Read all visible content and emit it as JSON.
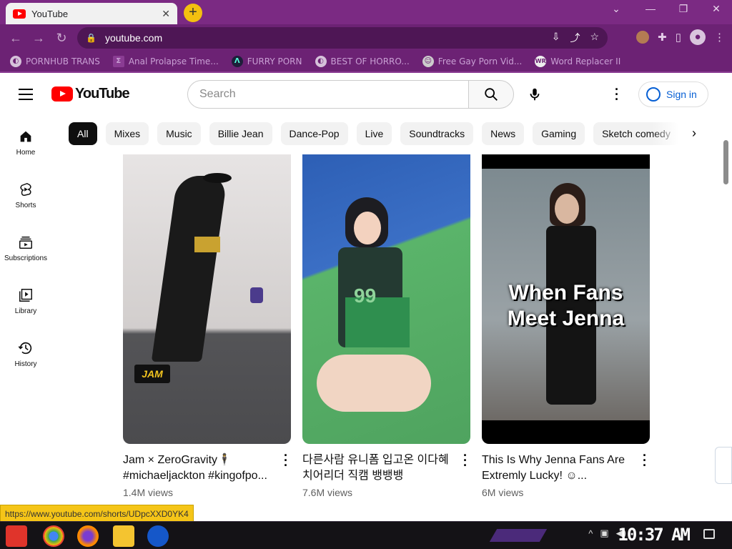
{
  "browser": {
    "tab_title": "YouTube",
    "tab_close": "✕",
    "new_tab": "+",
    "url": "youtube.com",
    "bookmarks": [
      {
        "label": "PORNHUB TRANS",
        "icon": "globe-icon"
      },
      {
        "label": "Anal Prolapse Time...",
        "icon": "film-icon"
      },
      {
        "label": "FURRY PORN",
        "icon": "triangle-icon"
      },
      {
        "label": "BEST OF HORRO...",
        "icon": "globe-icon"
      },
      {
        "label": "Free Gay Porn Vid...",
        "icon": "person-icon"
      },
      {
        "label": "Word Replacer II",
        "icon": "wr-icon"
      }
    ],
    "status_url": "https://www.youtube.com/shorts/UDpcXXD0YK4"
  },
  "youtube": {
    "logo_text": "YouTube",
    "search_placeholder": "Search",
    "signin_label": "Sign in",
    "chips": [
      "All",
      "Mixes",
      "Music",
      "Billie Jean",
      "Dance-Pop",
      "Live",
      "Soundtracks",
      "News",
      "Gaming",
      "Sketch comedy"
    ],
    "sidebar": [
      {
        "label": "Home",
        "icon": "home-icon"
      },
      {
        "label": "Shorts",
        "icon": "shorts-icon"
      },
      {
        "label": "Subscriptions",
        "icon": "subscriptions-icon"
      },
      {
        "label": "Library",
        "icon": "library-icon"
      },
      {
        "label": "History",
        "icon": "history-icon"
      }
    ],
    "shorts": [
      {
        "title": "Jam × ZeroGravity🕴️ #michaeljackton #kingofpo...",
        "views": "1.4M views",
        "overlay": "JAM"
      },
      {
        "title": "다른사람 유니폼 입고온 이다혜 치어리더 직캠 뱅뱅뱅",
        "views": "7.6M views",
        "overlay": "99"
      },
      {
        "title": "This Is Why Jenna Fans Are Extremly Lucky! ☺...",
        "views": "6M views",
        "overlay": "When Fans Meet Jenna"
      }
    ]
  },
  "taskbar": {
    "clock": "10:37 AM"
  }
}
